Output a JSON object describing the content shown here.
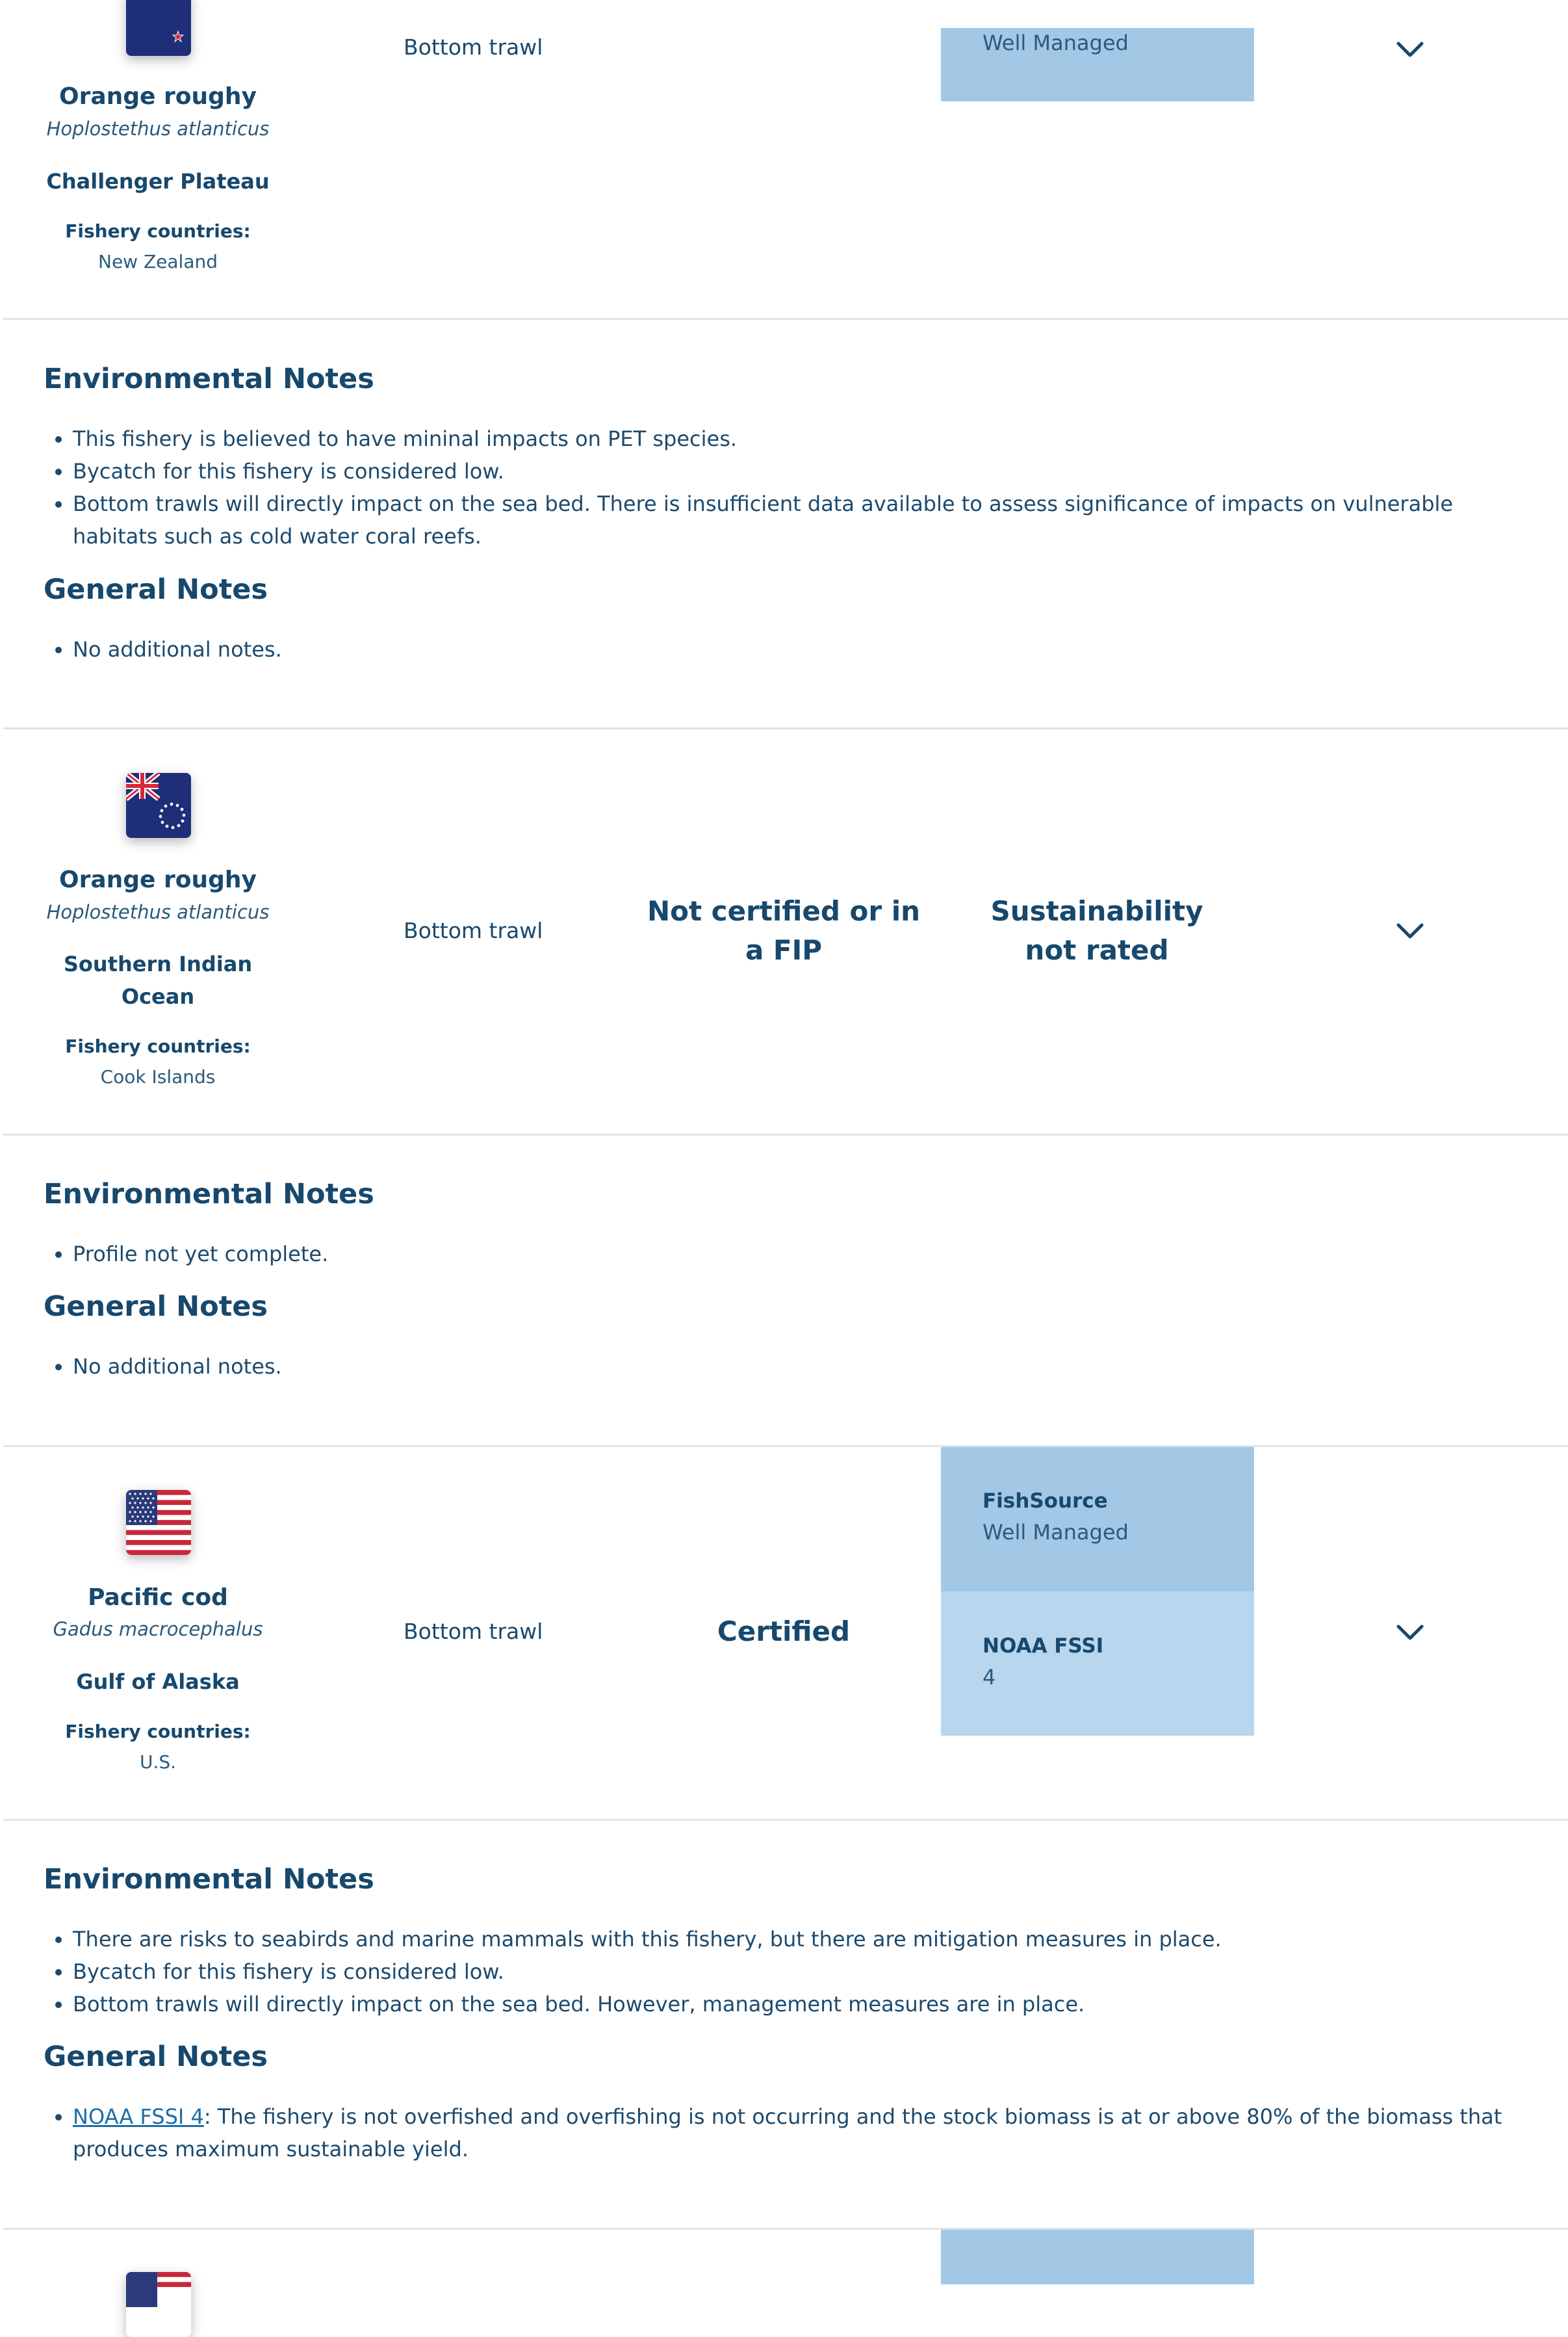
{
  "colors": {
    "primary_text": "#17486d",
    "rating_panel_dark": "#a3c8e6",
    "rating_panel_light": "#b8d6ee",
    "divider": "#e0e4e8",
    "link": "#1c6ea8"
  },
  "rows": [
    {
      "flag": "new-zealand-flag-icon",
      "species": "Orange roughy",
      "scientific": "Hoplostethus atlanticus",
      "area": "Challenger Plateau",
      "countries_label": "Fishery countries:",
      "countries": "New Zealand",
      "gear": "Bottom trawl",
      "rating_text": "Well Managed",
      "expand_icon": "chevron-down-icon",
      "env_heading": "Environmental Notes",
      "env_notes": [
        "This fishery is believed to have mininal impacts on PET species.",
        "Bycatch for this fishery is considered low.",
        "Bottom trawls will directly impact on the sea bed. There is insufficient data available to assess significance of impacts on vulnerable habitats such as cold water coral reefs."
      ],
      "gen_heading": "General Notes",
      "gen_notes": [
        "No additional notes."
      ]
    },
    {
      "flag": "cook-islands-flag-icon",
      "species": "Orange roughy",
      "scientific": "Hoplostethus atlanticus",
      "area_line1": "Southern Indian",
      "area_line2": "Ocean",
      "countries_label": "Fishery countries:",
      "countries": "Cook Islands",
      "gear": "Bottom trawl",
      "certification_line1": "Not certified or in",
      "certification_line2": "a FIP",
      "rating_line1": "Sustainability",
      "rating_line2": "not rated",
      "expand_icon": "chevron-down-icon",
      "env_heading": "Environmental Notes",
      "env_notes": [
        "Profile not yet complete."
      ],
      "gen_heading": "General Notes",
      "gen_notes": [
        "No additional notes."
      ]
    },
    {
      "flag": "usa-flag-icon",
      "species": "Pacific cod",
      "scientific": "Gadus macrocephalus",
      "area": "Gulf of Alaska",
      "countries_label": "Fishery countries:",
      "countries": "U.S.",
      "gear": "Bottom trawl",
      "certification": "Certified",
      "rating_1_title": "FishSource",
      "rating_1_text": "Well Managed",
      "rating_2_title": "NOAA FSSI",
      "rating_2_text": "4",
      "expand_icon": "chevron-down-icon",
      "env_heading": "Environmental Notes",
      "env_notes": [
        "There are risks to seabirds and marine mammals with this fishery, but there are mitigation measures in place.",
        "Bycatch for this fishery is considered low.",
        "Bottom trawls will directly impact on the sea bed. However, management measures are in place."
      ],
      "gen_heading": "General Notes",
      "gen_link": "NOAA FSSI 4",
      "gen_note_rest": ": The fishery is not overfished and overfishing is not occurring and the stock biomass is at or above 80% of the biomass that produces maximum sustainable yield."
    },
    {
      "flag": "usa-flag-icon"
    }
  ]
}
